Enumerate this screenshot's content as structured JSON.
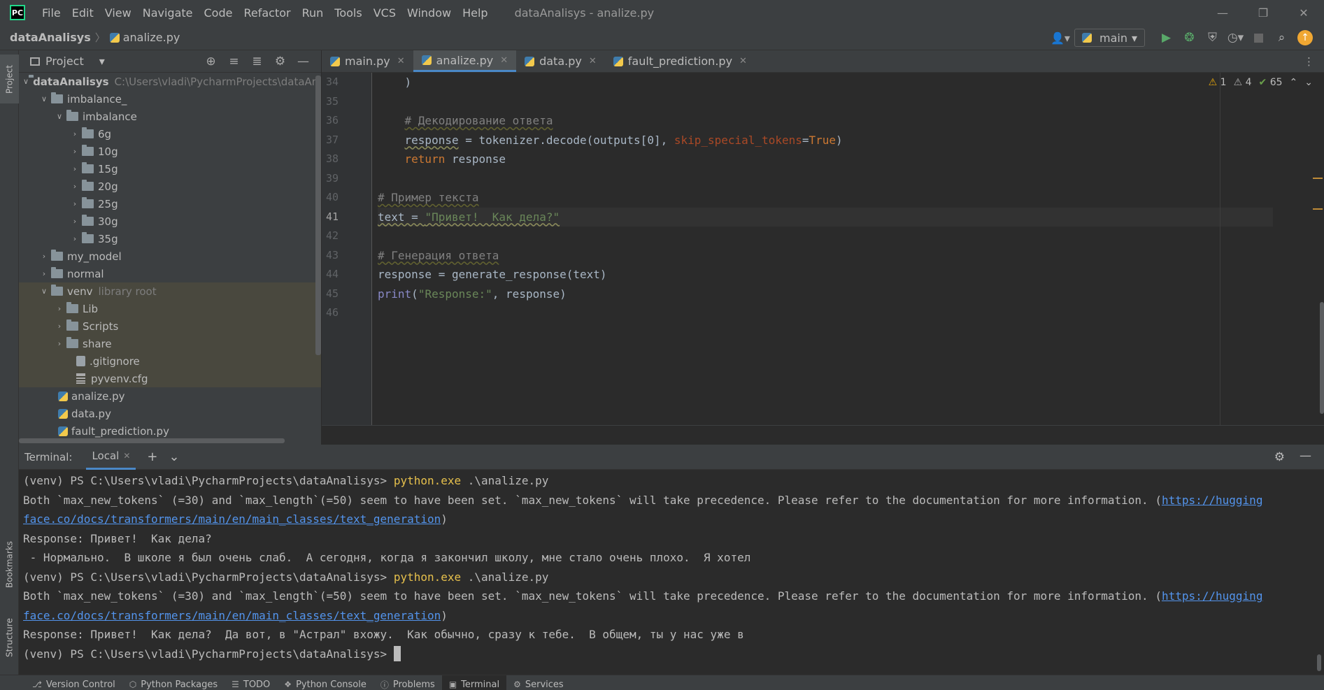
{
  "menubar": {
    "logo_text": "PC",
    "items": [
      "File",
      "Edit",
      "View",
      "Navigate",
      "Code",
      "Refactor",
      "Run",
      "Tools",
      "VCS",
      "Window",
      "Help"
    ],
    "window_title": "dataAnalisys - analize.py"
  },
  "navbar": {
    "project": "dataAnalisys",
    "file": "analize.py",
    "run_config": "main"
  },
  "left_stripe": {
    "project": "Project",
    "bookmarks": "Bookmarks",
    "structure": "Structure"
  },
  "project_panel": {
    "title": "Project",
    "tree": [
      {
        "label": "dataAnalisys",
        "extra": "C:\\Users\\vladi\\PycharmProjects\\dataAnalis"
      },
      {
        "label": "imbalance_"
      },
      {
        "label": "imbalance"
      },
      {
        "label": "6g"
      },
      {
        "label": "10g"
      },
      {
        "label": "15g"
      },
      {
        "label": "20g"
      },
      {
        "label": "25g"
      },
      {
        "label": "30g"
      },
      {
        "label": "35g"
      },
      {
        "label": "my_model"
      },
      {
        "label": "normal"
      },
      {
        "label": "venv",
        "extra": "library root"
      },
      {
        "label": "Lib"
      },
      {
        "label": "Scripts"
      },
      {
        "label": "share"
      },
      {
        "label": ".gitignore"
      },
      {
        "label": "pyvenv.cfg"
      },
      {
        "label": "analize.py"
      },
      {
        "label": "data.py"
      },
      {
        "label": "fault_prediction.py"
      }
    ]
  },
  "editor": {
    "tabs": [
      "main.py",
      "analize.py",
      "data.py",
      "fault_prediction.py"
    ],
    "active_tab": "analize.py",
    "line_numbers": [
      "34",
      "35",
      "36",
      "37",
      "38",
      "39",
      "40",
      "41",
      "42",
      "43",
      "44",
      "45",
      "46"
    ],
    "inspections": {
      "errors": "1",
      "warnings": "4",
      "ok": "65"
    },
    "code": {
      "l34": ")",
      "l36_comment": "# Декодирование ответа",
      "l37_a": "response",
      "l37_b": " = tokenizer.decode(outputs[0], ",
      "l37_param": "skip_special_tokens",
      "l37_eq": "=",
      "l37_kw": "True",
      "l37_end": ")",
      "l38_kw": "return",
      "l38_rest": " response",
      "l40_comment": "# Пример текста",
      "l41_text": "text = ",
      "l41_str": "\"Привет!  Как дела?\"",
      "l43_comment": "# Генерация ответа",
      "l44": "response = generate_response(text)",
      "l45_fn": "print",
      "l45_open": "(",
      "l45_str": "\"Response:\"",
      "l45_rest": ", response)"
    }
  },
  "terminal": {
    "title": "Terminal:",
    "tab": "Local",
    "prompt": "(venv) PS C:\\Users\\vladi\\PycharmProjects\\dataAnalisys> ",
    "command": "python.exe",
    "command_arg": " .\\analize.py",
    "warn_text": "Both `max_new_tokens` (=30) and `max_length`(=50) seem to have been set. `max_new_tokens` will take precedence. Please refer to the documentation for more information. (",
    "link_part1": "https://hugging",
    "link_part2": "face.co/docs/transformers/main/en/main_classes/text_generation",
    "link_close": ")",
    "response1": "Response: Привет!  Как дела?",
    "response1_cont": " - Нормально.  В школе я был очень слаб.  А сегодня, когда я закончил школу, мне стало очень плохо.  Я хотел",
    "response2": "Response: Привет!  Как дела?  Да вот, в \"Астрал\" вхожу.  Как обычно, сразу к тебе.  В общем, ты у нас уже в"
  },
  "bottom_bar": [
    "Version Control",
    "Python Packages",
    "TODO",
    "Python Console",
    "Problems",
    "Terminal",
    "Services"
  ],
  "colors": {
    "background": "#2b2b2b",
    "panel": "#3c3f41",
    "accent": "#4a88c7",
    "keyword": "#cc7832",
    "string": "#6a8759"
  }
}
